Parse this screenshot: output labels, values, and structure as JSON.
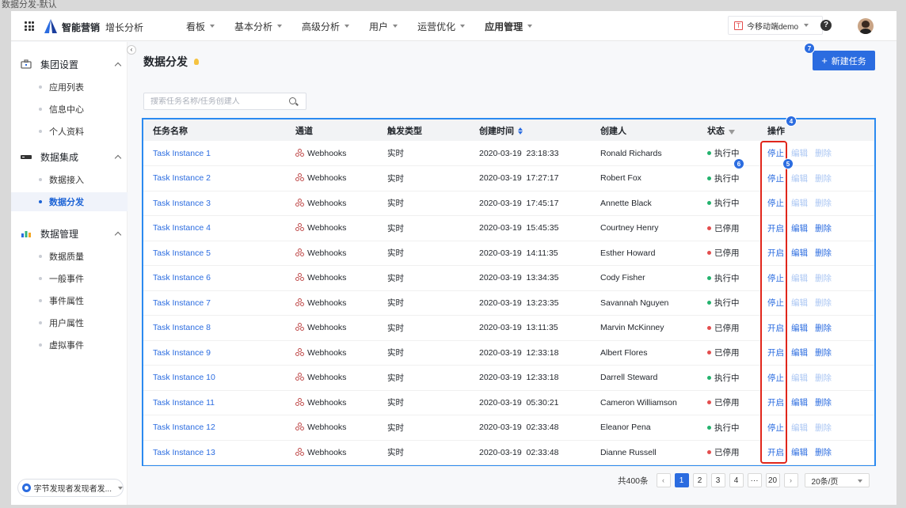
{
  "window_caption": "数据分发-默认",
  "topnav": {
    "brand": "智能营销",
    "product": "增长分析",
    "menu": [
      {
        "label": "看板",
        "active": false
      },
      {
        "label": "基本分析",
        "active": false
      },
      {
        "label": "高级分析",
        "active": false
      },
      {
        "label": "用户",
        "active": false
      },
      {
        "label": "运营优化",
        "active": false
      },
      {
        "label": "应用管理",
        "active": true
      }
    ],
    "project": {
      "tag": "T",
      "label": "今移动端demo"
    },
    "help_glyph": "?"
  },
  "sidebar": {
    "collapse_glyph": "‹",
    "groups": [
      {
        "title": "集团设置",
        "icon": "briefcase-icon",
        "items": [
          {
            "label": "应用列表"
          },
          {
            "label": "信息中心"
          },
          {
            "label": "个人资料"
          }
        ]
      },
      {
        "title": "数据集成",
        "icon": "server-icon",
        "items": [
          {
            "label": "数据接入"
          },
          {
            "label": "数据分发",
            "active": true
          }
        ]
      },
      {
        "title": "数据管理",
        "icon": "bar-chart-icon",
        "items": [
          {
            "label": "数据质量"
          },
          {
            "label": "一般事件"
          },
          {
            "label": "事件属性"
          },
          {
            "label": "用户属性"
          },
          {
            "label": "虚拟事件"
          }
        ]
      }
    ],
    "org_selector": "字节发现者发现者发..."
  },
  "page": {
    "title": "数据分发",
    "new_task_button": "新建任务",
    "search_placeholder": "搜索任务名称/任务创建人"
  },
  "annotations": {
    "new_task": "7",
    "ops_header": "4",
    "row_status": "6",
    "row_ops": "5"
  },
  "table": {
    "columns": [
      "任务名称",
      "通道",
      "触发类型",
      "创建时间",
      "创建人",
      "状态",
      "操作"
    ],
    "rows": [
      {
        "name": "Task Instance 1",
        "channel": "Webhooks",
        "trigger": "实时",
        "created": "2020-03-19  23:18:33",
        "creator": "Ronald Richards",
        "status": "执行中",
        "running": true,
        "action": "停止",
        "edit": "编辑",
        "delete": "删除"
      },
      {
        "name": "Task Instance 2",
        "channel": "Webhooks",
        "trigger": "实时",
        "created": "2020-03-19  17:27:17",
        "creator": "Robert Fox",
        "status": "执行中",
        "running": true,
        "action": "停止",
        "edit": "编辑",
        "delete": "删除"
      },
      {
        "name": "Task Instance 3",
        "channel": "Webhooks",
        "trigger": "实时",
        "created": "2020-03-19  17:45:17",
        "creator": "Annette Black",
        "status": "执行中",
        "running": true,
        "action": "停止",
        "edit": "编辑",
        "delete": "删除"
      },
      {
        "name": "Task Instance 4",
        "channel": "Webhooks",
        "trigger": "实时",
        "created": "2020-03-19  15:45:35",
        "creator": "Courtney Henry",
        "status": "已停用",
        "running": false,
        "action": "开启",
        "edit": "编辑",
        "delete": "删除"
      },
      {
        "name": "Task Instance 5",
        "channel": "Webhooks",
        "trigger": "实时",
        "created": "2020-03-19  14:11:35",
        "creator": "Esther Howard",
        "status": "已停用",
        "running": false,
        "action": "开启",
        "edit": "编辑",
        "delete": "删除"
      },
      {
        "name": "Task Instance 6",
        "channel": "Webhooks",
        "trigger": "实时",
        "created": "2020-03-19  13:34:35",
        "creator": "Cody Fisher",
        "status": "执行中",
        "running": true,
        "action": "停止",
        "edit": "编辑",
        "delete": "删除"
      },
      {
        "name": "Task Instance 7",
        "channel": "Webhooks",
        "trigger": "实时",
        "created": "2020-03-19  13:23:35",
        "creator": "Savannah Nguyen",
        "status": "执行中",
        "running": true,
        "action": "停止",
        "edit": "编辑",
        "delete": "删除"
      },
      {
        "name": "Task Instance 8",
        "channel": "Webhooks",
        "trigger": "实时",
        "created": "2020-03-19  13:11:35",
        "creator": "Marvin McKinney",
        "status": "已停用",
        "running": false,
        "action": "开启",
        "edit": "编辑",
        "delete": "删除"
      },
      {
        "name": "Task Instance 9",
        "channel": "Webhooks",
        "trigger": "实时",
        "created": "2020-03-19  12:33:18",
        "creator": "Albert Flores",
        "status": "已停用",
        "running": false,
        "action": "开启",
        "edit": "编辑",
        "delete": "删除"
      },
      {
        "name": "Task Instance 10",
        "channel": "Webhooks",
        "trigger": "实时",
        "created": "2020-03-19  12:33:18",
        "creator": "Darrell Steward",
        "status": "执行中",
        "running": true,
        "action": "停止",
        "edit": "编辑",
        "delete": "删除"
      },
      {
        "name": "Task Instance 11",
        "channel": "Webhooks",
        "trigger": "实时",
        "created": "2020-03-19  05:30:21",
        "creator": "Cameron Williamson",
        "status": "已停用",
        "running": false,
        "action": "开启",
        "edit": "编辑",
        "delete": "删除"
      },
      {
        "name": "Task Instance 12",
        "channel": "Webhooks",
        "trigger": "实时",
        "created": "2020-03-19  02:33:48",
        "creator": "Eleanor Pena",
        "status": "执行中",
        "running": true,
        "action": "停止",
        "edit": "编辑",
        "delete": "删除"
      },
      {
        "name": "Task Instance 13",
        "channel": "Webhooks",
        "trigger": "实时",
        "created": "2020-03-19  02:33:48",
        "creator": "Dianne Russell",
        "status": "已停用",
        "running": false,
        "action": "开启",
        "edit": "编辑",
        "delete": "删除"
      }
    ]
  },
  "pagination": {
    "total": "共400条",
    "prev": "‹",
    "next": "›",
    "pages": [
      "1",
      "2",
      "3",
      "4",
      "···",
      "20"
    ],
    "current": "1",
    "page_size": "20条/页"
  },
  "colors": {
    "accent": "#2b6ce0",
    "running": "#23b26d",
    "stopped": "#e34d4d",
    "highlight": "#e0261b"
  }
}
